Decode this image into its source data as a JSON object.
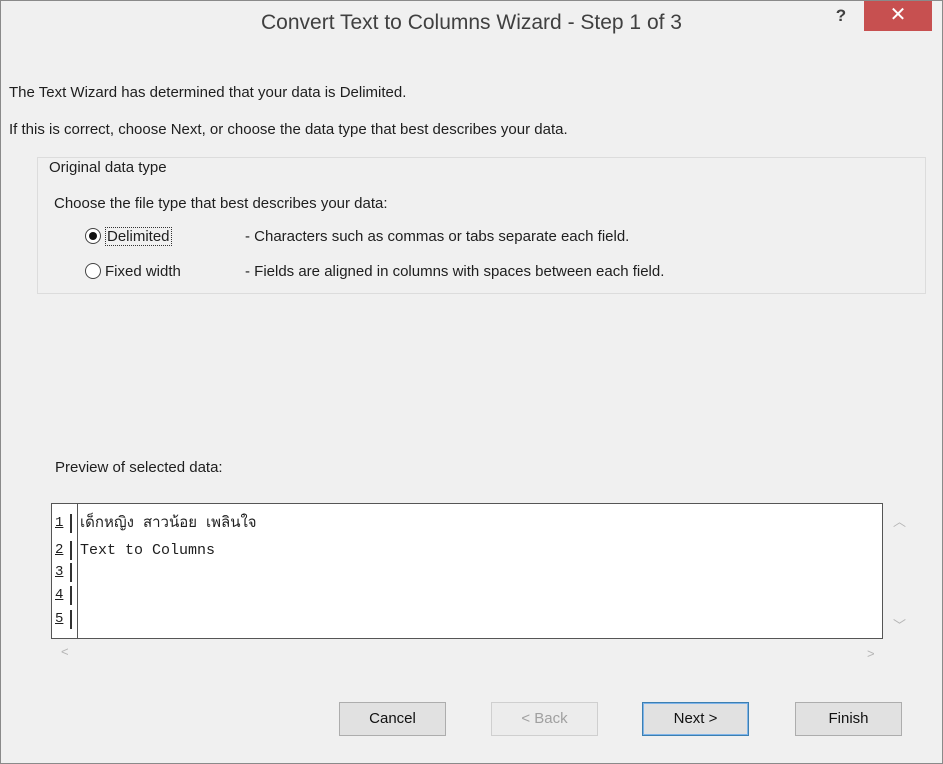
{
  "dialog": {
    "title": "Convert Text to Columns Wizard - Step 1 of 3",
    "help_label": "?",
    "close_label": "✕"
  },
  "message": {
    "line1": "The Text Wizard has determined that your data is Delimited.",
    "line2": "If this is correct, choose Next, or choose the data type that best describes your data."
  },
  "data_type": {
    "group_label": "Original data type",
    "prompt": "Choose the file type that best describes your data:",
    "options": [
      {
        "label": "Delimited",
        "description": "- Characters such as commas or tabs separate each field.",
        "selected": true
      },
      {
        "label": "Fixed width",
        "description": "- Fields are aligned in columns with spaces between each field.",
        "selected": false
      }
    ]
  },
  "preview": {
    "label": "Preview of selected data:",
    "rows": [
      {
        "num": "1",
        "text": "เด็กหญิง สาวน้อย เพลินใจ"
      },
      {
        "num": "2",
        "text": "Text to Columns"
      },
      {
        "num": "3",
        "text": ""
      },
      {
        "num": "4",
        "text": ""
      },
      {
        "num": "5",
        "text": ""
      }
    ]
  },
  "buttons": {
    "cancel": "Cancel",
    "back": "< Back",
    "next": "Next >",
    "finish": "Finish"
  },
  "colors": {
    "close_button_bg": "#c75050",
    "dialog_bg": "#f0f0f0",
    "default_button_border": "#3c7fb1"
  }
}
